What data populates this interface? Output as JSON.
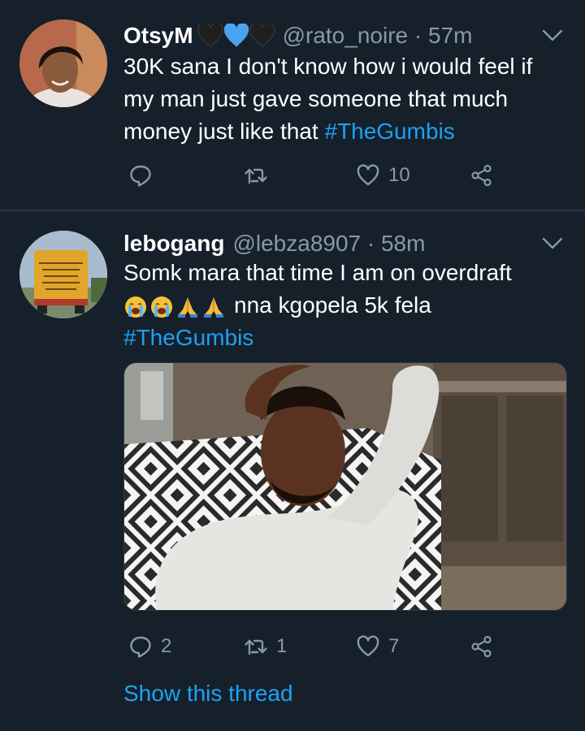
{
  "tweets": [
    {
      "name": "OtsyM",
      "handle": "@rato_noire · 57m",
      "body_lines": [
        "30K sana I don't know how i would feel if",
        "my man just gave someone that much",
        "money just like that"
      ],
      "hashtag": "#TheGumbis",
      "replies": "",
      "retweets": "",
      "likes": "10"
    },
    {
      "name": "lebogang",
      "handle": "@lebza8907 · 58m",
      "body_line1": "Somk mara that time I am on overdraft",
      "body_line2": "nna kgopela 5k fela",
      "hashtag": "#TheGumbis",
      "replies": "2",
      "retweets": "1",
      "likes": "7",
      "avatar_sign_text": "THANK YOU FOR DOUBTING ME. IT MADE ME WORK EVEN HARDER"
    }
  ],
  "show_thread": "Show this thread",
  "colors": {
    "background": "#15202b",
    "accent": "#1da1f2",
    "secondary_text": "#8899a6",
    "divider": "#2a3744"
  },
  "icons": [
    "reply-icon",
    "retweet-icon",
    "like-icon",
    "share-icon",
    "chevron-down-icon",
    "blue-heart-icon",
    "black-heart-icon",
    "crying-face-emoji",
    "folded-hands-emoji"
  ]
}
